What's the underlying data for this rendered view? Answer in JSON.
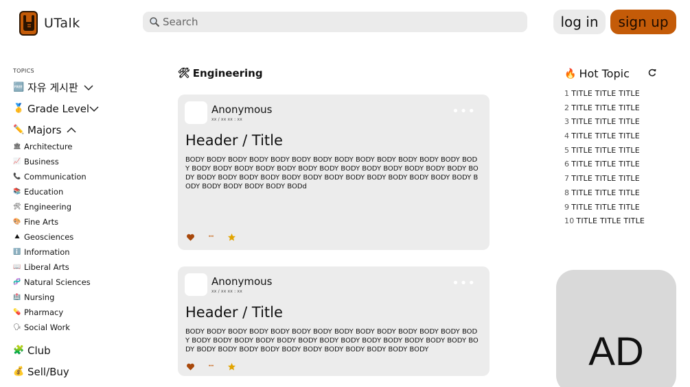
{
  "header": {
    "brand": "UTalk",
    "search_placeholder": "Search",
    "login_label": "log in",
    "signup_label": "sign up",
    "accent": "#c45b08"
  },
  "sidebar": {
    "topics_label": "TOPICS",
    "free_board": {
      "emoji": "🆓",
      "label": "자유 게시판"
    },
    "grade_level": {
      "emoji": "🥇",
      "label": "Grade Level"
    },
    "majors": {
      "emoji": "✏️",
      "label": "Majors",
      "items": [
        {
          "emoji": "🏛",
          "label": "Architecture"
        },
        {
          "emoji": "📈",
          "label": "Business"
        },
        {
          "emoji": "📞",
          "label": "Communication"
        },
        {
          "emoji": "📚",
          "label": "Education"
        },
        {
          "emoji": "🛠",
          "label": "Engineering"
        },
        {
          "emoji": "🎨",
          "label": "Fine Arts"
        },
        {
          "emoji": "⛰",
          "label": "Geosciences"
        },
        {
          "emoji": "ℹ️",
          "label": "Information"
        },
        {
          "emoji": "📖",
          "label": "Liberal Arts"
        },
        {
          "emoji": "🧬",
          "label": "Natural Sciences"
        },
        {
          "emoji": "🏥",
          "label": "Nursing"
        },
        {
          "emoji": "💊",
          "label": "Pharmacy"
        },
        {
          "emoji": "🗣",
          "label": "Social Work"
        }
      ]
    },
    "club": {
      "emoji": "🧩",
      "label": "Club"
    },
    "sell_buy": {
      "emoji": "💰",
      "label": "Sell/Buy"
    }
  },
  "feed": {
    "emoji": "🛠",
    "title": "Engineering",
    "posts": [
      {
        "author": "Anonymous",
        "date": "xx / xx   xx : xx",
        "more": "•••",
        "title": "Header / Title",
        "body": "BODY BODY BODY BODY BODY BODY BODY BODY BODY BODY BODY BODY BODY BODY BODY BODY BODY BODY BODY BODY BODY BODY BODY BODY BODY BODY BODY BODY BODY BODY BODY BODY BODY BODY BODY BODY BODY BODY BODY BODY BODY BODY BODY BODY BODY BODY BODd",
        "actions_more": "···"
      },
      {
        "author": "Anonymous",
        "date": "xx / xx   xx : xx",
        "more": "•••",
        "title": "Header / Title",
        "body": "BODY BODY BODY BODY BODY BODY BODY BODY BODY BODY BODY BODY BODY BODY BODY BODY BODY BODY BODY BODY BODY BODY BODY BODY BODY BODY BODY BODY BODY BODY BODY BODY BODY BODY BODY BODY BODY BODY BODY",
        "actions_more": "···"
      }
    ]
  },
  "hot_topics": {
    "emoji": "🔥",
    "title": "Hot Topic",
    "items": [
      {
        "num": "1",
        "title": "TITLE TITLE TITLE"
      },
      {
        "num": "2",
        "title": "TITLE TITLE TITLE"
      },
      {
        "num": "3",
        "title": "TITLE TITLE TITLE"
      },
      {
        "num": "4",
        "title": "TITLE TITLE TITLE"
      },
      {
        "num": "5",
        "title": "TITLE TITLE TITLE"
      },
      {
        "num": "6",
        "title": "TITLE TITLE TITLE"
      },
      {
        "num": "7",
        "title": "TITLE TITLE TITLE"
      },
      {
        "num": "8",
        "title": "TITLE TITLE TITLE"
      },
      {
        "num": "9",
        "title": "TITLE TITLE TITLE"
      },
      {
        "num": "10",
        "title": "TITLE TITLE TITLE"
      }
    ]
  },
  "ad": {
    "label": "AD"
  }
}
